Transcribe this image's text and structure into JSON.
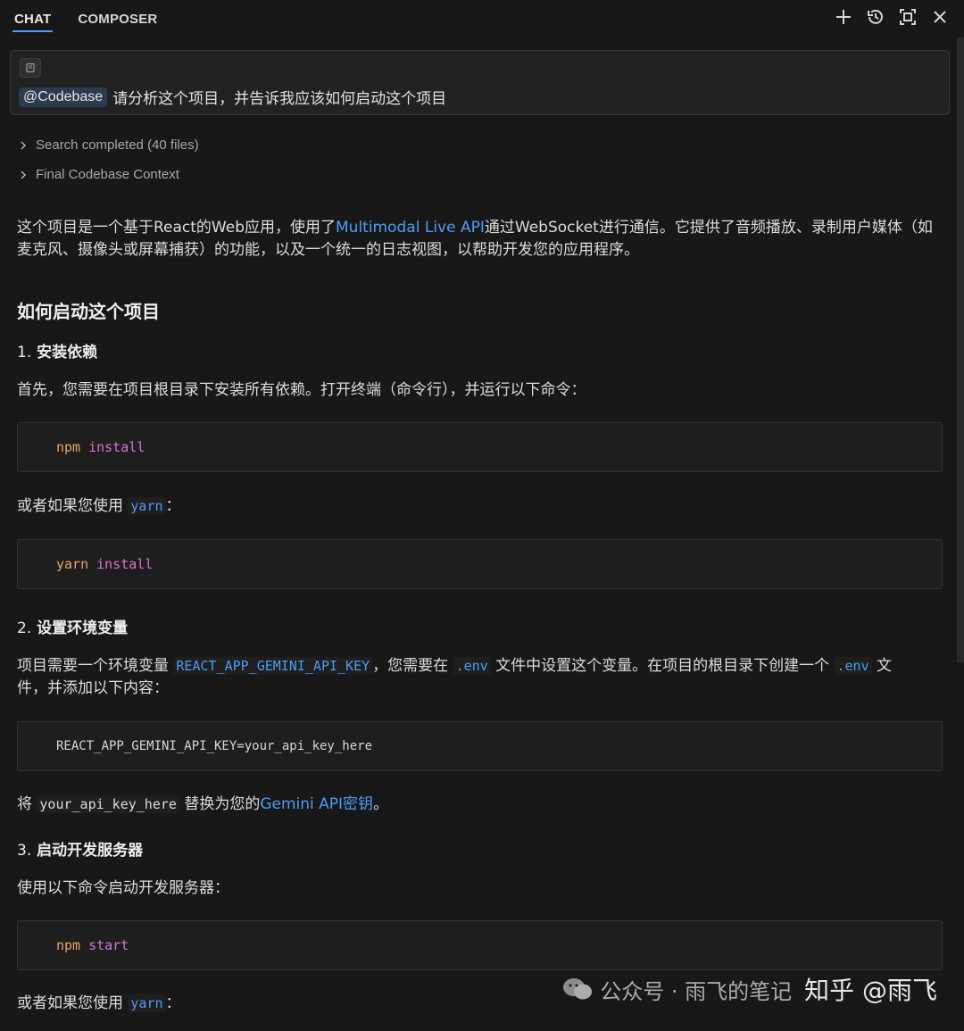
{
  "tabs": [
    {
      "label": "CHAT",
      "active": true
    },
    {
      "label": "COMPOSER",
      "active": false
    }
  ],
  "toolbar_icons": [
    "plus-icon",
    "history-icon",
    "maximize-icon",
    "close-icon"
  ],
  "prompt": {
    "mention": "@Codebase",
    "text": "请分析这个项目，并告诉我应该如何启动这个项目"
  },
  "steps": [
    {
      "label": "Search completed (40 files)"
    },
    {
      "label": "Final Codebase Context"
    }
  ],
  "answer": {
    "intro_a": "这个项目是一个基于React的Web应用，使用了",
    "intro_link": "Multimodal Live API",
    "intro_b": "通过WebSocket进行通信。它提供了音频播放、录制用户媒体（如",
    "intro_c": "麦克风、摄像头或屏幕捕获）的功能，以及一个统一的日志视图，以帮助开发您的应用程序。",
    "heading": "如何启动这个项目",
    "sections": [
      {
        "num": "1.",
        "title": "安装依赖",
        "desc": "首先，您需要在项目根目录下安装所有依赖。打开终端（命令行），并运行以下命令：",
        "code1_cmd": "npm",
        "code1_arg": "install",
        "alt_prefix": "或者如果您使用",
        "alt_code": "yarn",
        "alt_suffix": "：",
        "code2_cmd": "yarn",
        "code2_arg": "install"
      },
      {
        "num": "2.",
        "title": "设置环境变量",
        "desc_a": "项目需要一个环境变量",
        "var_name": "REACT_APP_GEMINI_API_KEY",
        "desc_b": "，您需要在",
        "env_file": ".env",
        "desc_c": "文件中设置这个变量。在项目的根目录下创建一个",
        "env_file2": ".env",
        "desc_d": "文",
        "desc_e": "件，并添加以下内容：",
        "code": "REACT_APP_GEMINI_API_KEY=your_api_key_here",
        "replace_a": "将",
        "replace_code": "your_api_key_here",
        "replace_b": "替换为您的",
        "replace_link": "Gemini API密钥",
        "replace_c": "。"
      },
      {
        "num": "3.",
        "title": "启动开发服务器",
        "desc": "使用以下命令启动开发服务器：",
        "code_cmd": "npm",
        "code_arg": "start",
        "alt_prefix": "或者如果您使用",
        "alt_code": "yarn",
        "alt_suffix": "："
      }
    ]
  },
  "watermark": {
    "wechat": "公众号 · 雨飞的笔记",
    "zhihu": "知乎 @雨飞"
  }
}
